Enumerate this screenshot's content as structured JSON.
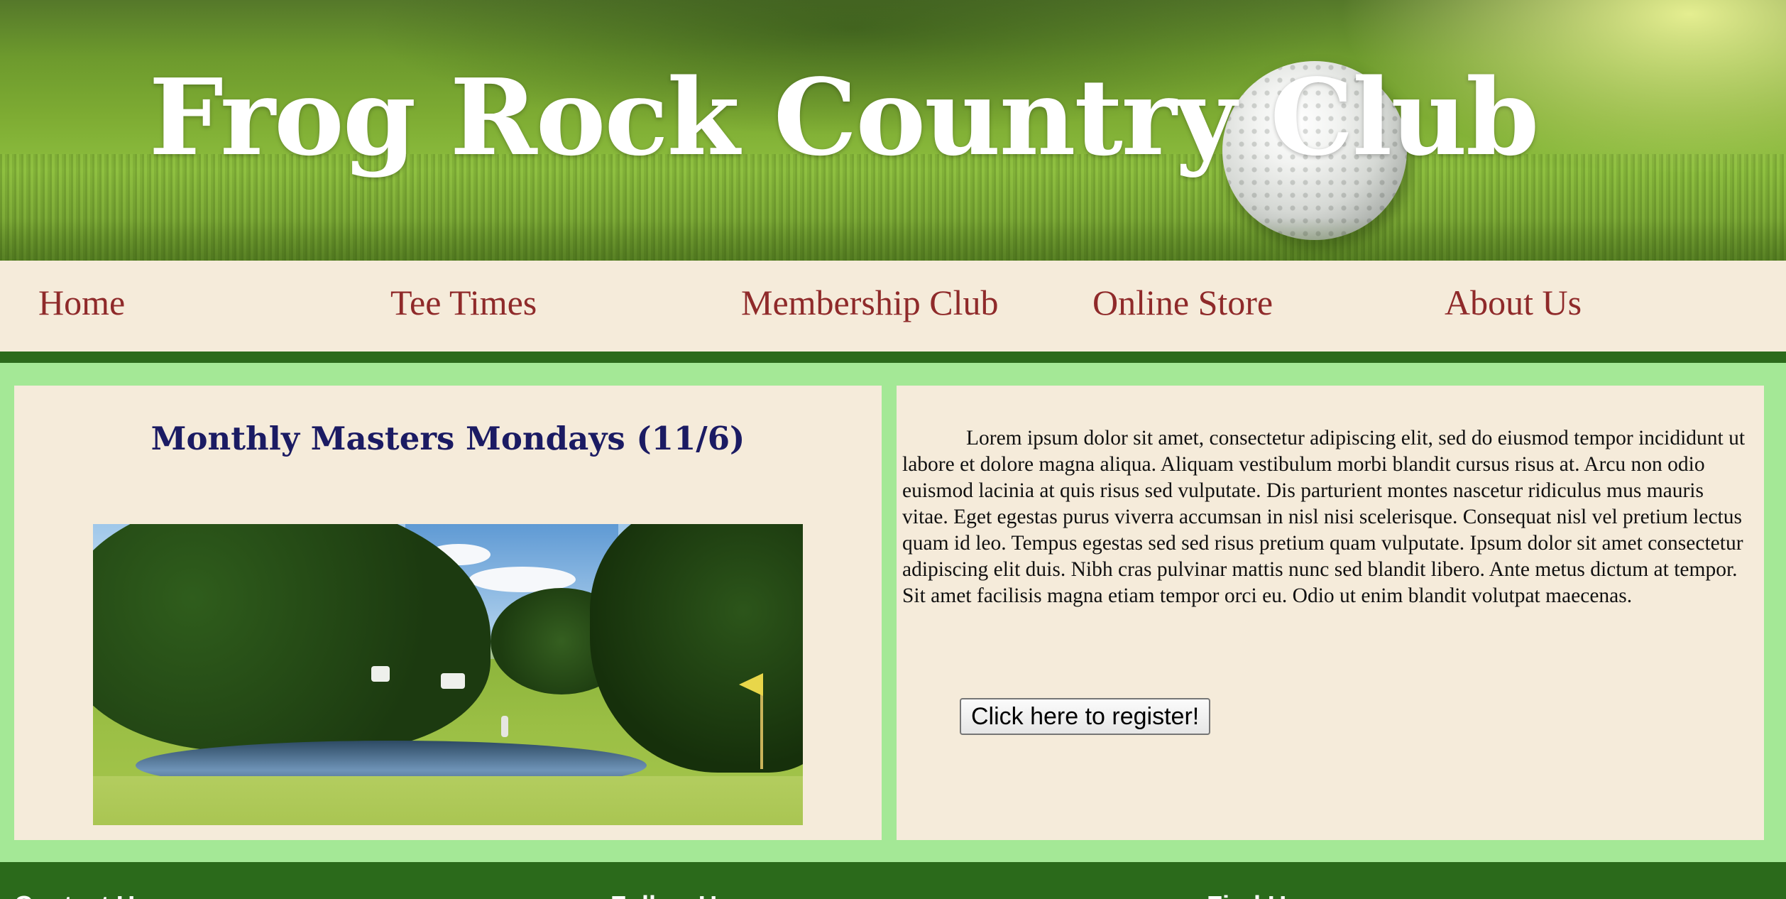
{
  "site": {
    "title": "Frog Rock Country Club"
  },
  "nav": {
    "items": [
      {
        "label": "Home"
      },
      {
        "label": "Tee Times"
      },
      {
        "label": "Membership Club"
      },
      {
        "label": "Online Store"
      },
      {
        "label": "About Us"
      }
    ]
  },
  "event": {
    "title": "Monthly Masters Mondays (11/6)",
    "description": "Lorem ipsum dolor sit amet, consectetur adipiscing elit, sed do eiusmod tempor incididunt ut labore et dolore magna aliqua. Aliquam vestibulum morbi blandit cursus risus at. Arcu non odio euismod lacinia at quis risus sed vulputate. Dis parturient montes nascetur ridiculus mus mauris vitae. Eget egestas purus viverra accumsan in nisl nisi scelerisque. Consequat nisl vel pretium lectus quam id leo. Tempus egestas sed sed risus pretium quam vulputate. Ipsum dolor sit amet consectetur adipiscing elit duis. Nibh cras pulvinar mattis nunc sed blandit libero. Ante metus dictum at tempor. Sit amet facilisis magna etiam tempor orci eu. Odio ut enim blandit volutpat maecenas.",
    "register_label": "Click here to register!"
  },
  "footer": {
    "headings": [
      {
        "label": "Contact Us"
      },
      {
        "label": "Follow Us"
      },
      {
        "label": "Find Us"
      }
    ]
  },
  "colors": {
    "nav_text": "#8f2a2a",
    "panel_bg": "#f5ebda",
    "page_bg": "#a4e896",
    "dark_green": "#2b6a1b",
    "event_title": "#1b1b63"
  }
}
